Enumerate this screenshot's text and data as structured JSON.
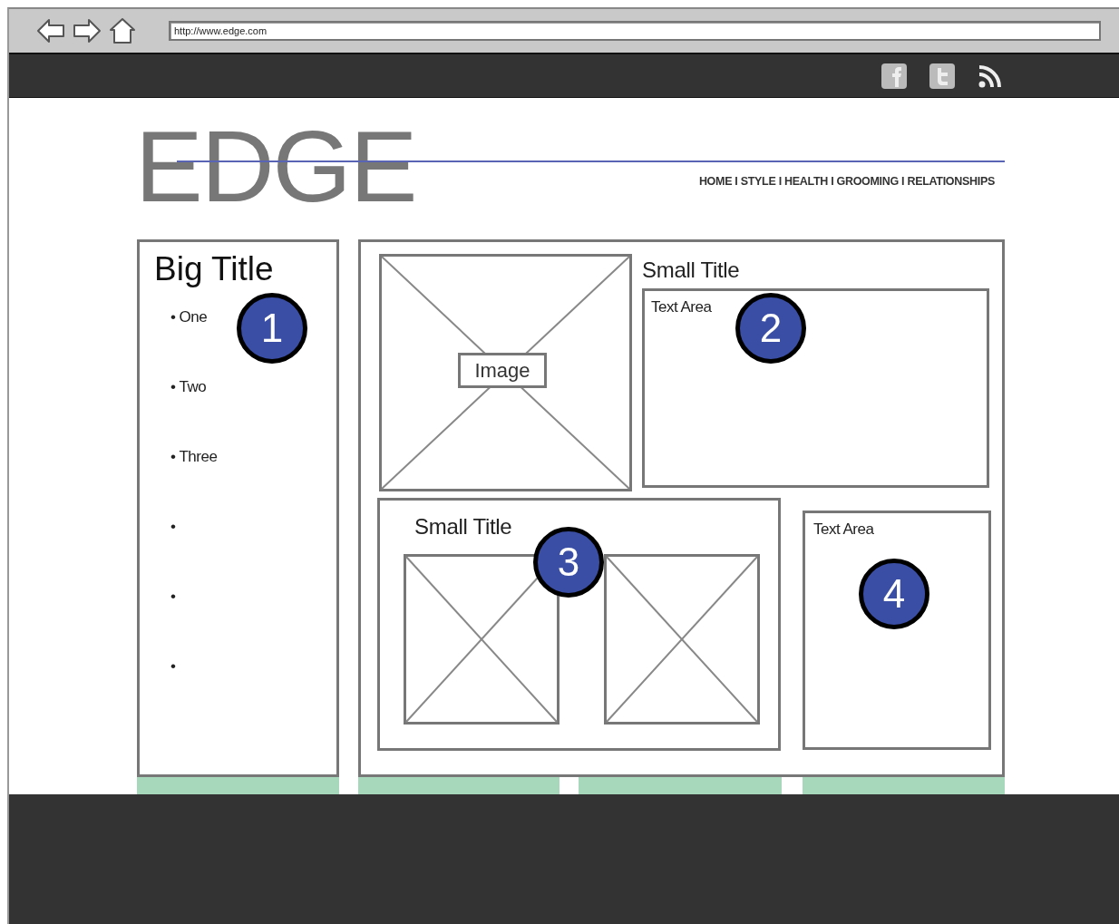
{
  "browser": {
    "url": "http://www.edge.com"
  },
  "header": {
    "logo": "EDGE",
    "nav": "HOME I STYLE I HEALTH I GROOMING I RELATIONSHIPS"
  },
  "sidebar": {
    "title": "Big Title",
    "callout": "1",
    "items": [
      {
        "bullet": "•",
        "label": "One"
      },
      {
        "bullet": "•",
        "label": "Two"
      },
      {
        "bullet": "•",
        "label": "Three"
      },
      {
        "bullet": "•"
      },
      {
        "bullet": "•"
      },
      {
        "bullet": "•"
      }
    ]
  },
  "feature": {
    "image_label": "Image",
    "title": "Small Title",
    "text_area": "Text Area",
    "callout": "2"
  },
  "gallery": {
    "title": "Small Title",
    "callout": "3",
    "images": [
      {
        "kind": "placeholder"
      },
      {
        "kind": "placeholder"
      }
    ]
  },
  "side_text": {
    "text_area": "Text Area",
    "callout": "4"
  }
}
